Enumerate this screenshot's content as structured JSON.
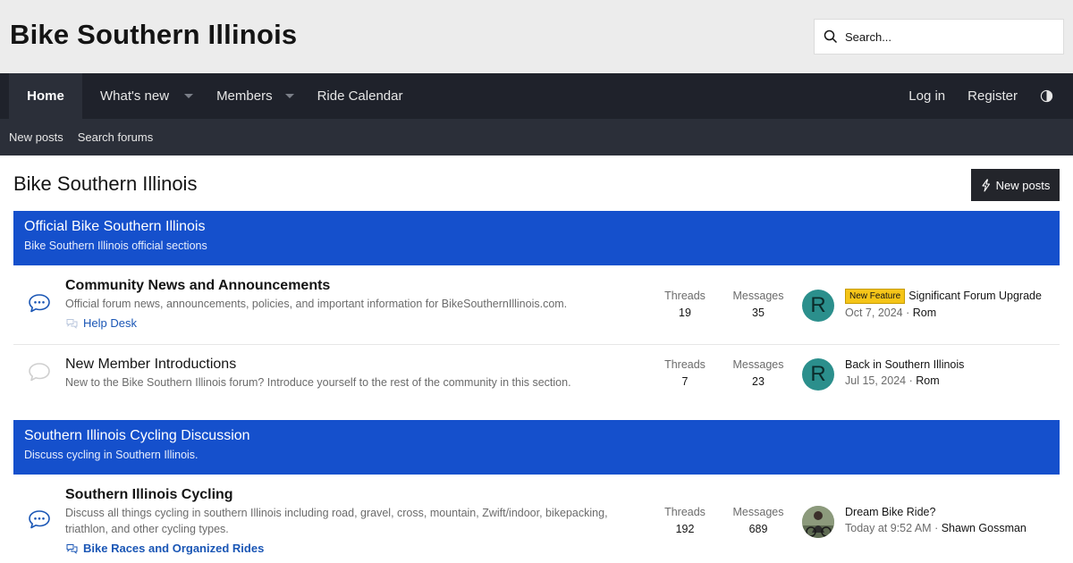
{
  "header": {
    "site_title": "Bike Southern Illinois",
    "search_placeholder": "Search..."
  },
  "nav": {
    "home": "Home",
    "whats_new": "What's new",
    "members": "Members",
    "ride_calendar": "Ride Calendar",
    "log_in": "Log in",
    "register": "Register"
  },
  "subnav": {
    "new_posts": "New posts",
    "search_forums": "Search forums"
  },
  "page": {
    "title": "Bike Southern Illinois",
    "new_posts_button": "New posts"
  },
  "categories": [
    {
      "title": "Official Bike Southern Illinois",
      "description": "Bike Southern Illinois official sections",
      "nodes": [
        {
          "title": "Community News and Announcements",
          "description": "Official forum news, announcements, policies, and important information for BikeSouthernIllinois.com.",
          "sub_forum": "Help Desk",
          "threads_label": "Threads",
          "threads": "19",
          "messages_label": "Messages",
          "messages": "35",
          "avatar_letter": "R",
          "last_prefix": "New Feature",
          "last_title": "Significant Forum Upgrade",
          "last_date": "Oct 7, 2024",
          "last_user": "Rom"
        },
        {
          "title": "New Member Introductions",
          "description": "New to the Bike Southern Illinois forum? Introduce yourself to the rest of the community in this section.",
          "threads_label": "Threads",
          "threads": "7",
          "messages_label": "Messages",
          "messages": "23",
          "avatar_letter": "R",
          "last_title": "Back in Southern Illinois",
          "last_date": "Jul 15, 2024",
          "last_user": "Rom"
        }
      ]
    },
    {
      "title": "Southern Illinois Cycling Discussion",
      "description": "Discuss cycling in Southern Illinois.",
      "nodes": [
        {
          "title": "Southern Illinois Cycling",
          "description": "Discuss all things cycling in southern Illinois including road, gravel, cross, mountain, Zwift/indoor, bikepacking, triathlon, and other cycling types.",
          "sub_forum": "Bike Races and Organized Rides",
          "threads_label": "Threads",
          "threads": "192",
          "messages_label": "Messages",
          "messages": "689",
          "last_title": "Dream Bike Ride?",
          "last_date": "Today at 9:52 AM",
          "last_user": "Shawn Gossman"
        }
      ]
    }
  ],
  "colors": {
    "accent": "#1550cc",
    "nav_bg": "#1f222b",
    "link": "#1a56b5",
    "avatar": "#2b8f8c",
    "badge": "#f5c518"
  },
  "icons": [
    "search-icon",
    "chevron-down-icon",
    "theme-toggle-icon",
    "bolt-icon",
    "forum-chat-icon",
    "subforum-icon"
  ]
}
